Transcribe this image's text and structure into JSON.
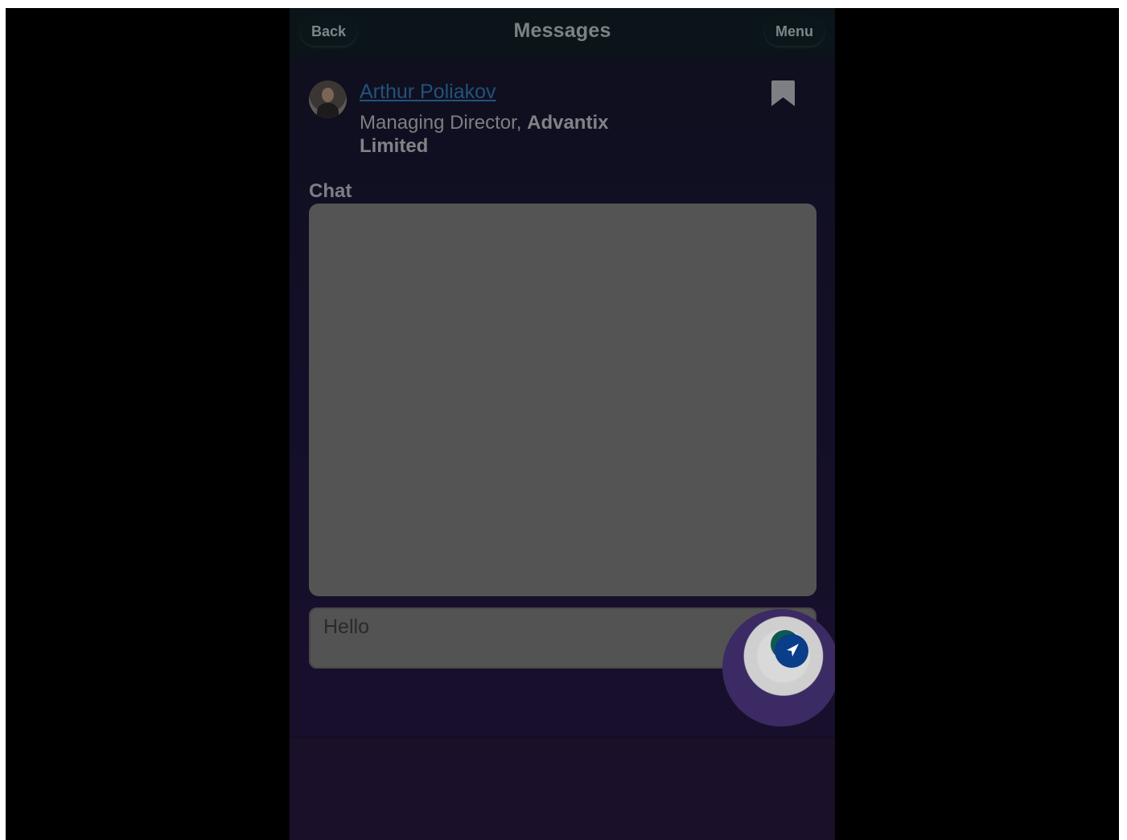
{
  "header": {
    "back_label": "Back",
    "title": "Messages",
    "menu_label": "Menu"
  },
  "contact": {
    "name": "Arthur Poliakov",
    "role_prefix": "Managing Director, ",
    "company": "Advantix Limited"
  },
  "chat": {
    "label": "Chat"
  },
  "composer": {
    "value": "Hello"
  },
  "icons": {
    "bookmark": "bookmark-icon",
    "send": "send-icon",
    "avatar": "avatar"
  },
  "colors": {
    "link": "#22527a",
    "send_button": "#0a3d8a",
    "spotlight": "#3b2a63"
  }
}
